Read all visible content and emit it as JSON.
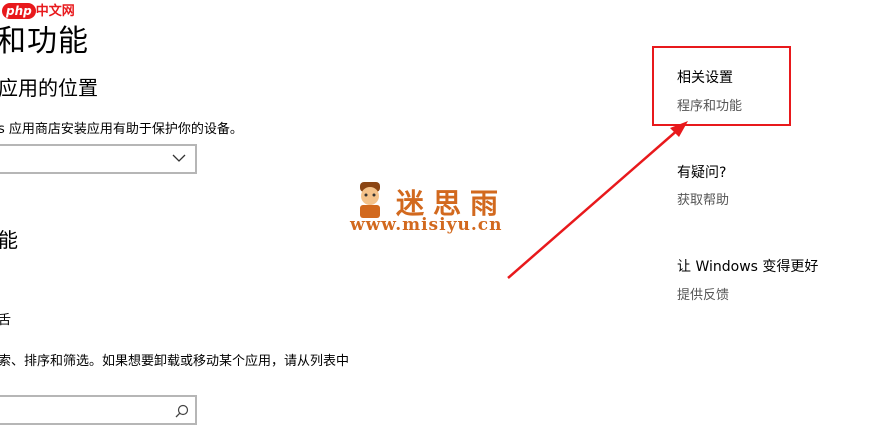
{
  "watermark": {
    "php_logo_badge": "php",
    "php_logo_text": "中文网",
    "site_name": "迷思雨",
    "site_url": "www.misiyu.cn"
  },
  "main": {
    "page_title": "和功能",
    "section_title": "应用的位置",
    "section_description": "s 应用商店安装应用有助于保护你的设备。",
    "dropdown_value": "",
    "subsection_title": "能",
    "small_label": "舌",
    "search_description": "索、排序和筛选。如果想要卸载或移动某个应用，请从列表中",
    "search_placeholder": ""
  },
  "sidebar": {
    "related_title": "相关设置",
    "programs_link": "程序和功能",
    "help_title": "有疑问?",
    "help_link": "获取帮助",
    "improve_title": "让 Windows 变得更好",
    "feedback_link": "提供反馈"
  },
  "annotation": {
    "highlight_color": "#e8191c"
  }
}
